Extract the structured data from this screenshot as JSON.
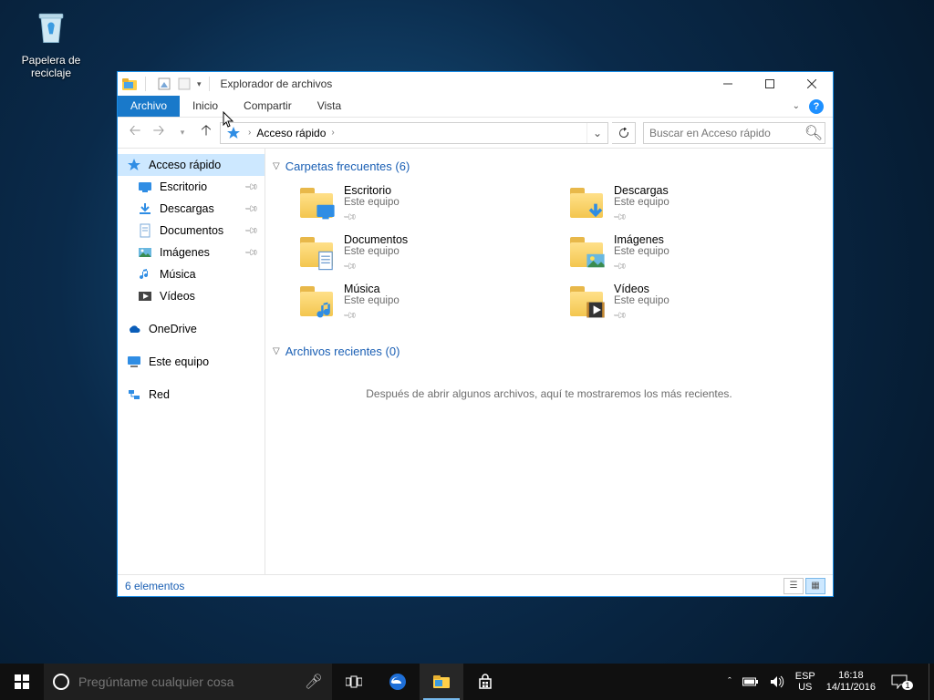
{
  "desktop": {
    "recycle_bin": "Papelera de reciclaje"
  },
  "window": {
    "title": "Explorador de archivos",
    "ribbon": {
      "file": "Archivo",
      "home": "Inicio",
      "share": "Compartir",
      "view": "Vista"
    },
    "breadcrumb": {
      "location": "Acceso rápido"
    },
    "search": {
      "placeholder": "Buscar en Acceso rápido"
    },
    "sidebar": {
      "quick_access": "Acceso rápido",
      "items": [
        {
          "label": "Escritorio",
          "pinned": true
        },
        {
          "label": "Descargas",
          "pinned": true
        },
        {
          "label": "Documentos",
          "pinned": true
        },
        {
          "label": "Imágenes",
          "pinned": true
        },
        {
          "label": "Música",
          "pinned": false
        },
        {
          "label": "Vídeos",
          "pinned": false
        }
      ],
      "onedrive": "OneDrive",
      "this_pc": "Este equipo",
      "network": "Red"
    },
    "groups": {
      "frequent": {
        "title": "Carpetas frecuentes (6)"
      },
      "recent": {
        "title": "Archivos recientes (0)",
        "empty_msg": "Después de abrir algunos archivos, aquí te mostraremos los más recientes."
      }
    },
    "tiles": [
      {
        "name": "Escritorio",
        "sub": "Este equipo"
      },
      {
        "name": "Descargas",
        "sub": "Este equipo"
      },
      {
        "name": "Documentos",
        "sub": "Este equipo"
      },
      {
        "name": "Imágenes",
        "sub": "Este equipo"
      },
      {
        "name": "Música",
        "sub": "Este equipo"
      },
      {
        "name": "Vídeos",
        "sub": "Este equipo"
      }
    ],
    "status": "6 elementos"
  },
  "taskbar": {
    "cortana_placeholder": "Pregúntame cualquier cosa",
    "lang1": "ESP",
    "lang2": "US",
    "time": "16:18",
    "date": "14/11/2016",
    "notif_count": "1"
  }
}
